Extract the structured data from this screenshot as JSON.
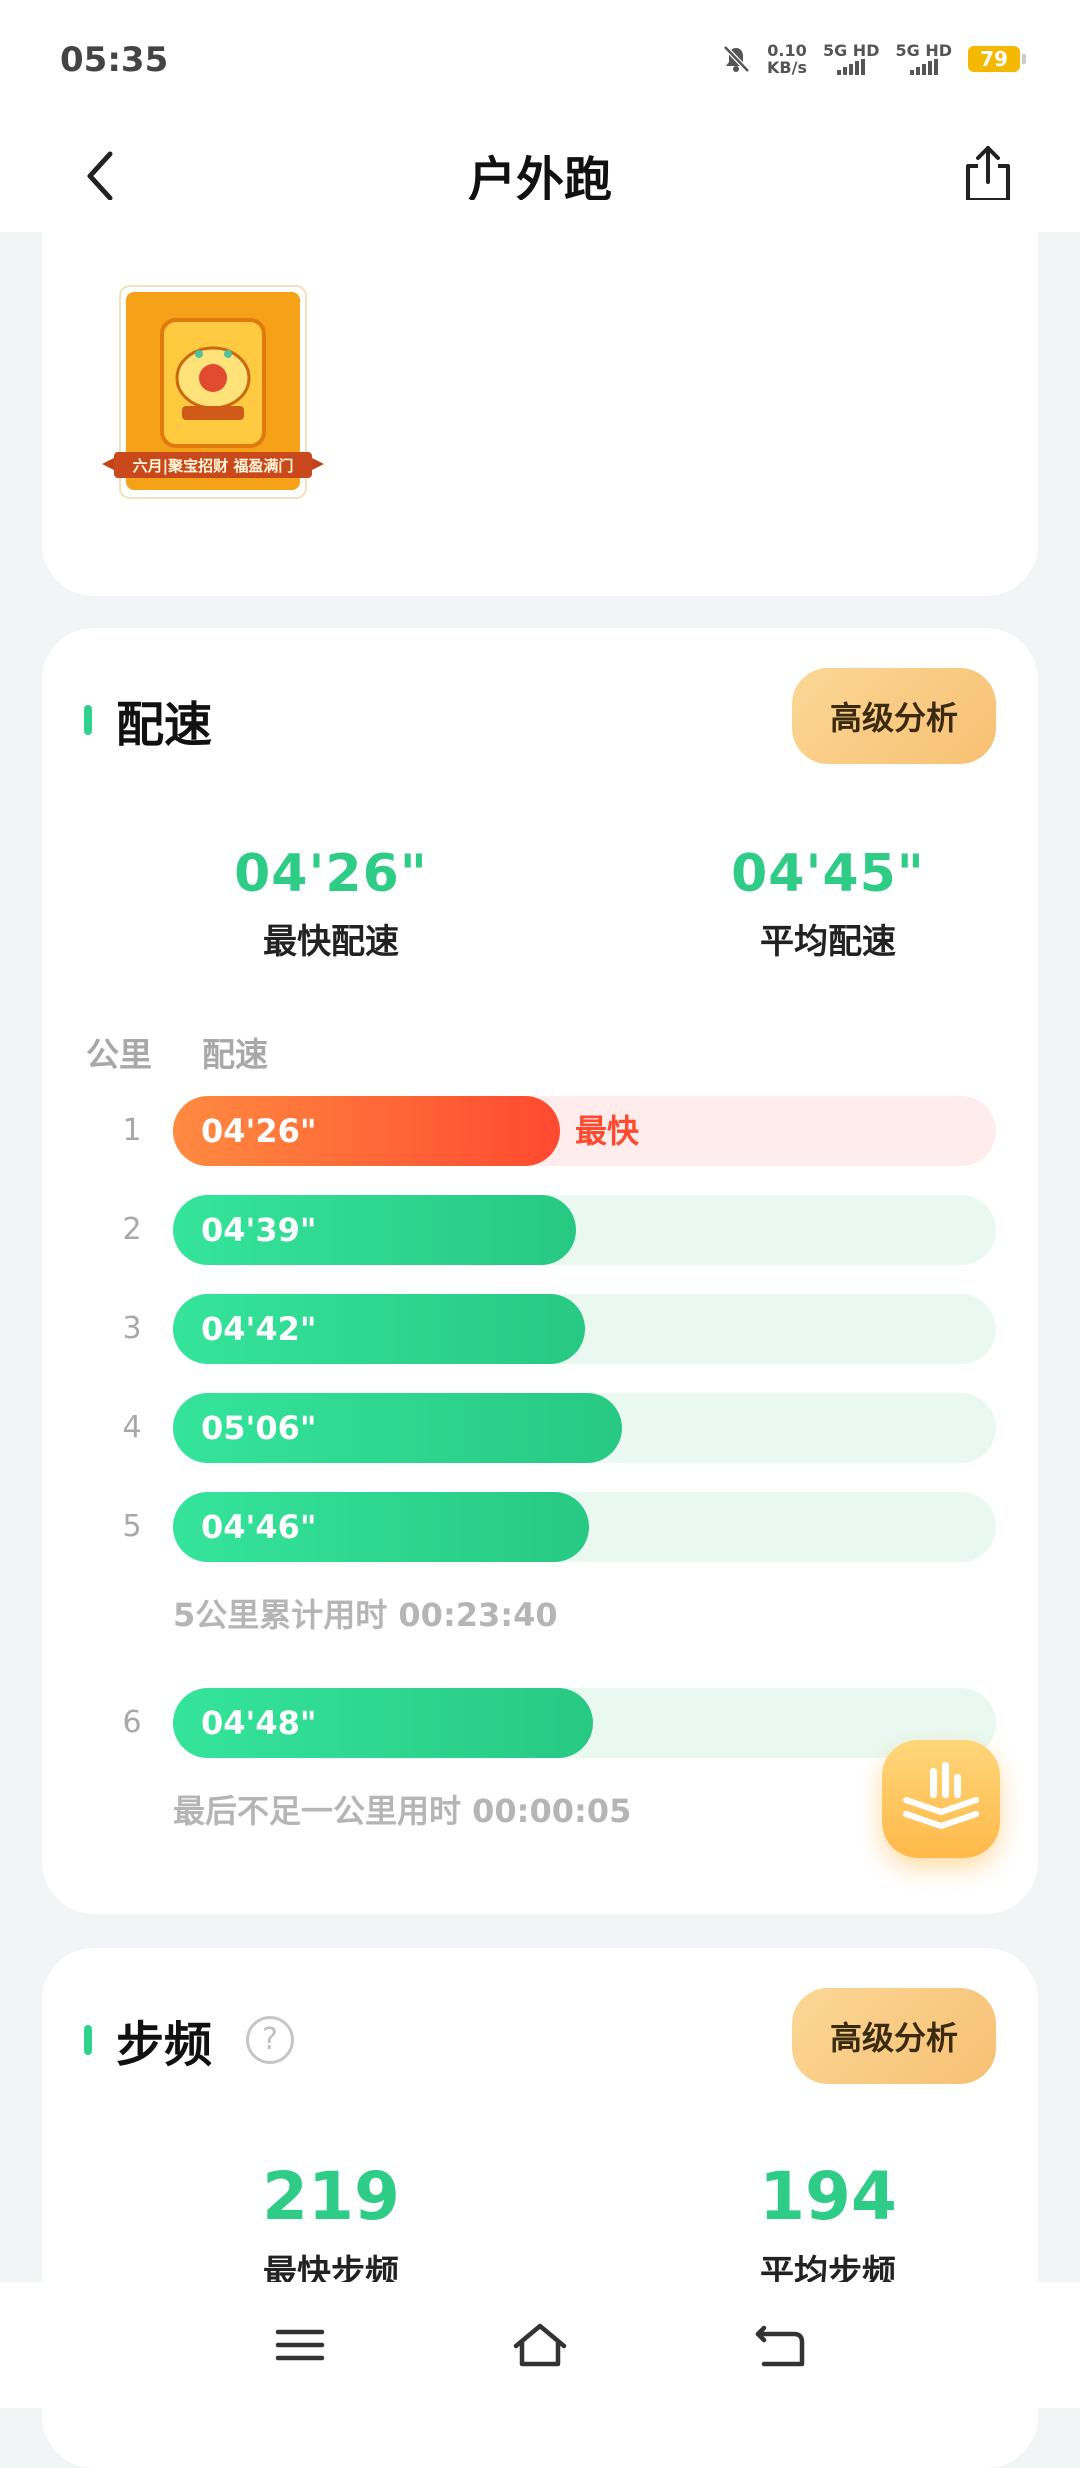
{
  "status_bar": {
    "time": "05:35",
    "net_speed_value": "0.10",
    "net_speed_unit": "KB/s",
    "sim1": "5G HD",
    "sim2": "5G HD",
    "battery": "79"
  },
  "header": {
    "title": "户外跑"
  },
  "medal": {
    "caption": "六月|聚宝招财 福盈满门"
  },
  "pace": {
    "section_title": "配速",
    "advanced_label": "高级分析",
    "fastest_value": "04'26\"",
    "fastest_label": "最快配速",
    "average_value": "04'45\"",
    "average_label": "平均配速",
    "col_km": "公里",
    "col_pace": "配速",
    "fastest_tag": "最快",
    "splits": [
      {
        "km": "1",
        "pace": "04'26\"",
        "ratio": 0.47,
        "fastest": true
      },
      {
        "km": "2",
        "pace": "04'39\"",
        "ratio": 0.49
      },
      {
        "km": "3",
        "pace": "04'42\"",
        "ratio": 0.5
      },
      {
        "km": "4",
        "pace": "05'06\"",
        "ratio": 0.545
      },
      {
        "km": "5",
        "pace": "04'46\"",
        "ratio": 0.505
      },
      {
        "km": "6",
        "pace": "04'48\"",
        "ratio": 0.51
      }
    ],
    "cumulative_note": "5公里累计用时 00:23:40",
    "last_note": "最后不足一公里用时 00:00:05"
  },
  "cadence": {
    "section_title": "步频",
    "help_label": "?",
    "advanced_label": "高级分析",
    "fastest_value": "219",
    "fastest_label": "最快步频",
    "average_value": "194",
    "average_label": "平均步频"
  },
  "colors": {
    "accent_green": "#2ecc87",
    "fastest_red": "#ff4a30",
    "button_gold": "#f7c072"
  },
  "icons": {
    "back": "chevron-left-icon",
    "share": "share-icon",
    "float": "chart-layers-icon",
    "nav": [
      "menu-icon",
      "home-icon",
      "back-nav-icon"
    ]
  }
}
